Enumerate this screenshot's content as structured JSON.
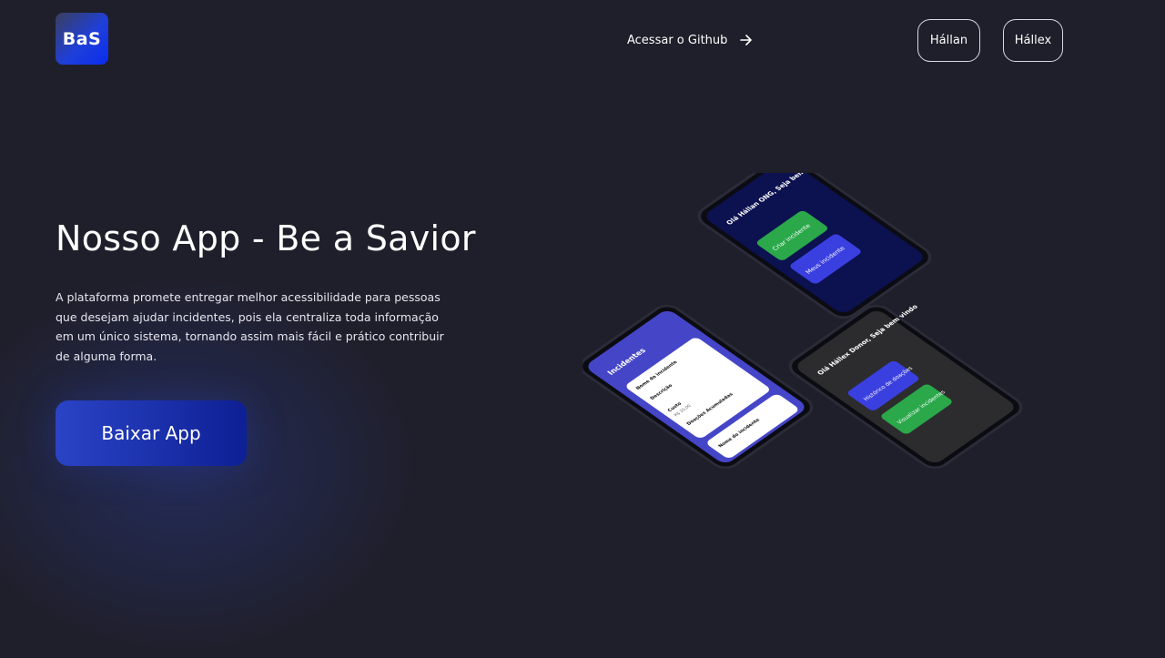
{
  "header": {
    "logo_text": "BaS",
    "github_link": "Acessar o Github",
    "nav_buttons": [
      "Hállan",
      "Hállex"
    ]
  },
  "hero": {
    "title": "Nosso App - Be a Savior",
    "description": "A plataforma promete entregar melhor acessibilidade para pessoas que desejam ajudar incidentes, pois ela centraliza toda informação em um único sistema, tornando assim mais fácil e prático contribuir de alguma forma.",
    "cta_label": "Baixar App"
  },
  "mockups": {
    "phone_ong": {
      "greeting": "Olá Hállan ONG, Seja bem vindo",
      "buttons": [
        "Criar incidente",
        "Meus incidente"
      ]
    },
    "phone_list": {
      "heading": "Incidentes",
      "card_fields": [
        "Nome do incidente",
        "Descrição",
        "Custo",
        "Doações Acumuladas"
      ],
      "cost_value": "R$ 20,00",
      "next_card": "Nome do incidente"
    },
    "phone_donor": {
      "greeting": "Olá Hállex Donor, Seja bem vindo",
      "buttons": [
        "Histórico de doações",
        "Visualizar incidentes"
      ]
    }
  },
  "colors": {
    "background": "#1f1f2b",
    "accent_blue": "#2a44c6",
    "accent_green": "#2aa84a"
  }
}
